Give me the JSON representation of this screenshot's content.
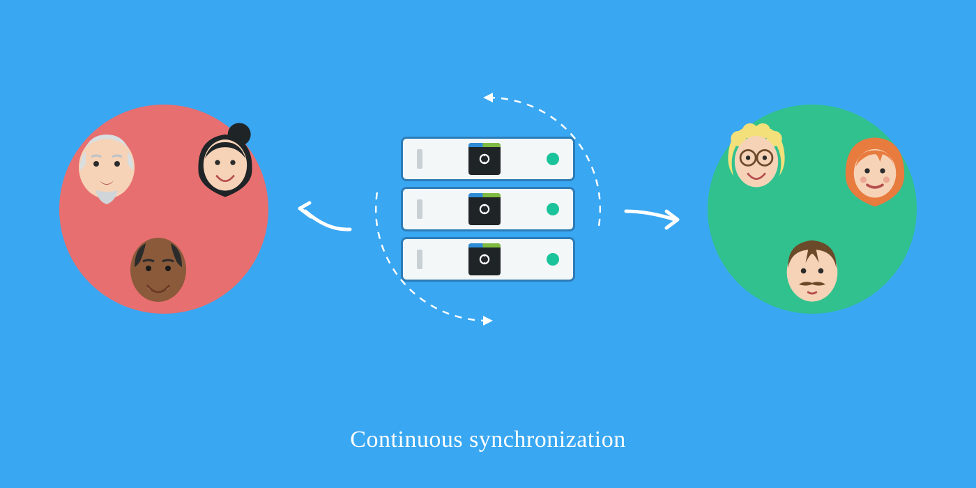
{
  "caption": "Continuous synchronization",
  "colors": {
    "background": "#39a7f2",
    "group_left": "#e86f6f",
    "group_right": "#31c18e",
    "unit_border": "#2c7cb8",
    "unit_fill": "#f4f7f8",
    "led": "#1bc39a"
  },
  "groups": {
    "left": {
      "faces": [
        "elderly-man",
        "dark-haired-woman",
        "bald-man"
      ]
    },
    "right": {
      "faces": [
        "blonde-glasses-person",
        "red-haired-woman",
        "mustache-man"
      ]
    }
  },
  "server_units": 3,
  "icons": {
    "sync": "infinity-sync-icon",
    "ring_arrows": "rotating-dashed-circle",
    "arrow_left": "curved-arrow-left",
    "arrow_right": "curved-arrow-right"
  }
}
